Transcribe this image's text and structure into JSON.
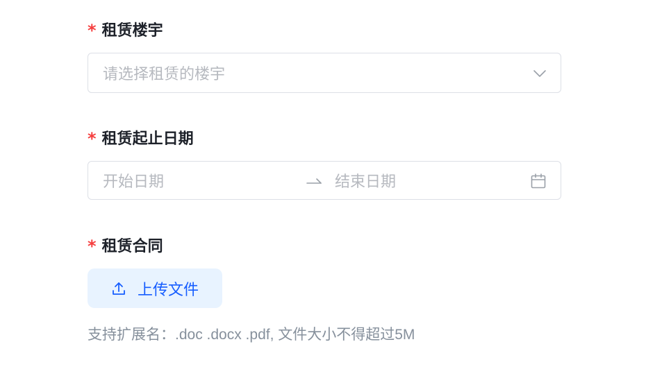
{
  "form": {
    "building": {
      "required_mark": "*",
      "label": "租赁楼宇",
      "placeholder": "请选择租赁的楼宇",
      "icon": "chevron-down-icon"
    },
    "lease_period": {
      "required_mark": "*",
      "label": "租赁起止日期",
      "start_placeholder": "开始日期",
      "end_placeholder": "结束日期",
      "separator_icon": "arrow-right-icon",
      "icon": "calendar-icon"
    },
    "contract": {
      "required_mark": "*",
      "label": "租赁合同",
      "upload_button_label": "上传文件",
      "upload_icon": "upload-icon",
      "hint": "支持扩展名：.doc .docx .pdf, 文件大小不得超过5M"
    }
  },
  "colors": {
    "required": "#f53f3f",
    "label_text": "#1d2129",
    "placeholder": "#b6b9bf",
    "border": "#dcdfe6",
    "primary": "#165dff",
    "upload_bg": "#e8f3ff",
    "hint_text": "#86909c"
  }
}
